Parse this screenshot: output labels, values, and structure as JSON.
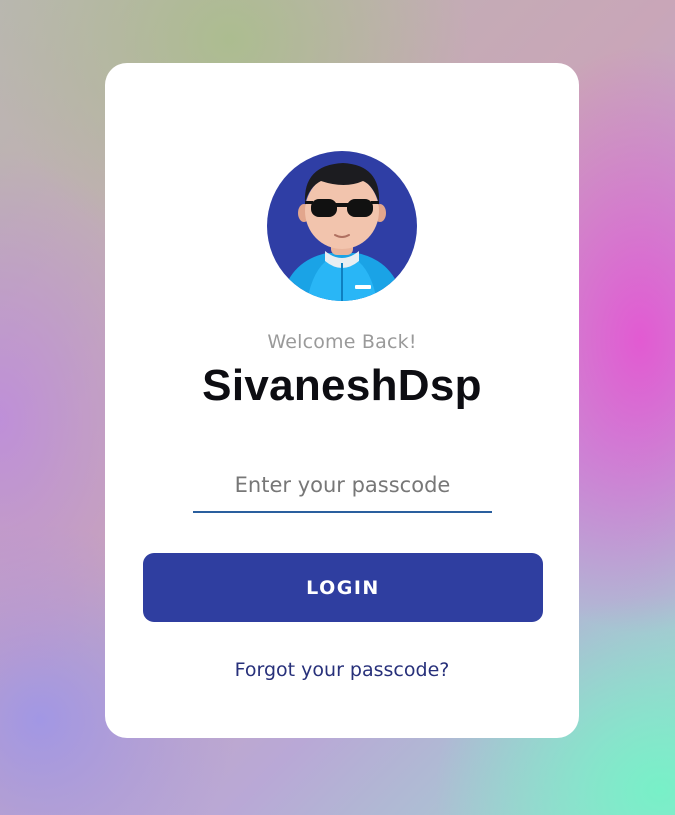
{
  "profile": {
    "avatar_icon": "user-avatar-3d",
    "welcome_text": "Welcome Back!",
    "username": "SivaneshDsp"
  },
  "login_form": {
    "passcode_placeholder": "Enter your passcode",
    "passcode_value": "",
    "login_label": "LOGIN",
    "forgot_link": "Forgot your passcode?"
  },
  "colors": {
    "primary": "#2f3ea0",
    "avatar_bg": "#2f3ea5",
    "input_underline": "#2a5f9e",
    "link": "#27307a"
  }
}
